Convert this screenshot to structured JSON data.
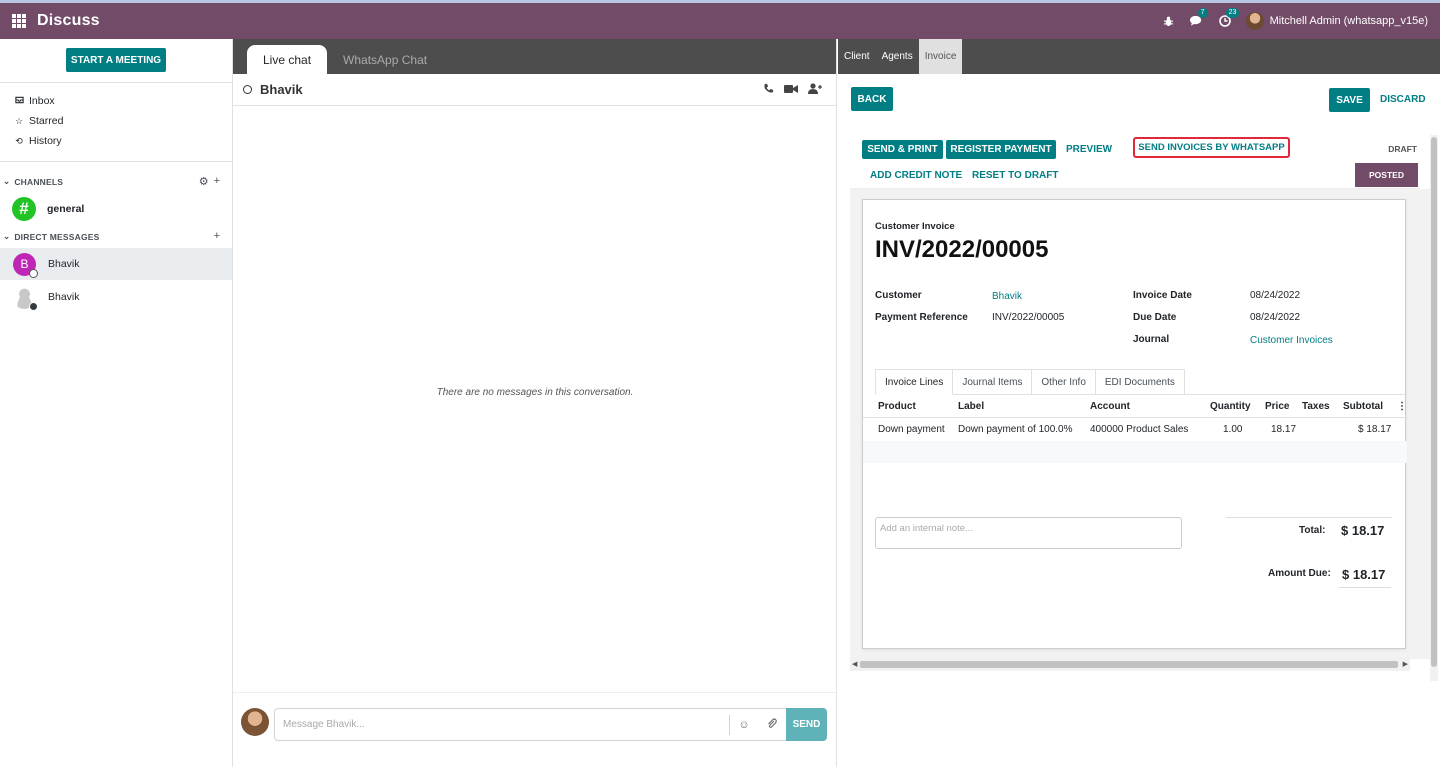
{
  "topbar": {
    "app_title": "Discuss",
    "chat_badge": "7",
    "activity_badge": "23",
    "user_name": "Mitchell Admin (whatsapp_v15e)"
  },
  "sidebar": {
    "start_meeting": "START A MEETING",
    "mailboxes": [
      {
        "label": "Inbox",
        "icon": "inbox-icon"
      },
      {
        "label": "Starred",
        "icon": "star-icon"
      },
      {
        "label": "History",
        "icon": "history-icon"
      }
    ],
    "channels_header": "CHANNELS",
    "channel_name": "general",
    "dm_header": "DIRECT MESSAGES",
    "dms": [
      {
        "name": "Bhavik",
        "initial": "B",
        "color": "#c026b5"
      },
      {
        "name": "Bhavik"
      }
    ]
  },
  "chat": {
    "tabs": [
      "Live chat",
      "WhatsApp Chat"
    ],
    "title": "Bhavik",
    "empty_text": "There are no messages in this conversation.",
    "composer_placeholder": "Message Bhavik...",
    "send_label": "SEND"
  },
  "invoice_panel": {
    "tabs": [
      "Client",
      "Agents",
      "Invoice"
    ],
    "back": "BACK",
    "save": "SAVE",
    "discard": "DISCARD",
    "actions": {
      "send_print": "SEND & PRINT",
      "register_payment": "REGISTER PAYMENT",
      "preview": "PREVIEW",
      "send_whatsapp": "SEND INVOICES BY WHATSAPP",
      "add_credit_note": "ADD CREDIT NOTE",
      "reset_to_draft": "RESET TO DRAFT"
    },
    "status": {
      "draft": "DRAFT",
      "posted": "POSTED"
    },
    "doc_type": "Customer Invoice",
    "number": "INV/2022/00005",
    "fields": {
      "customer_label": "Customer",
      "customer_value": "Bhavik",
      "payref_label": "Payment Reference",
      "payref_value": "INV/2022/00005",
      "invdate_label": "Invoice Date",
      "invdate_value": "08/24/2022",
      "duedate_label": "Due Date",
      "duedate_value": "08/24/2022",
      "journal_label": "Journal",
      "journal_value": "Customer Invoices"
    },
    "notebook_tabs": [
      "Invoice Lines",
      "Journal Items",
      "Other Info",
      "EDI Documents"
    ],
    "columns": [
      "Product",
      "Label",
      "Account",
      "Quantity",
      "Price",
      "Taxes",
      "Subtotal"
    ],
    "row": {
      "product": "Down payment",
      "label": "Down payment of 100.0%",
      "account": "400000 Product Sales",
      "quantity": "1.00",
      "price": "18.17",
      "taxes": "",
      "subtotal": "$ 18.17"
    },
    "note_placeholder": "Add an internal note...",
    "total_label": "Total:",
    "total_value": "$ 18.17",
    "amount_due_label": "Amount Due:",
    "amount_due_value": "$ 18.17"
  },
  "colors": {
    "brand": "#714B67",
    "accent": "#017e84",
    "highlight": "#e0283a"
  }
}
